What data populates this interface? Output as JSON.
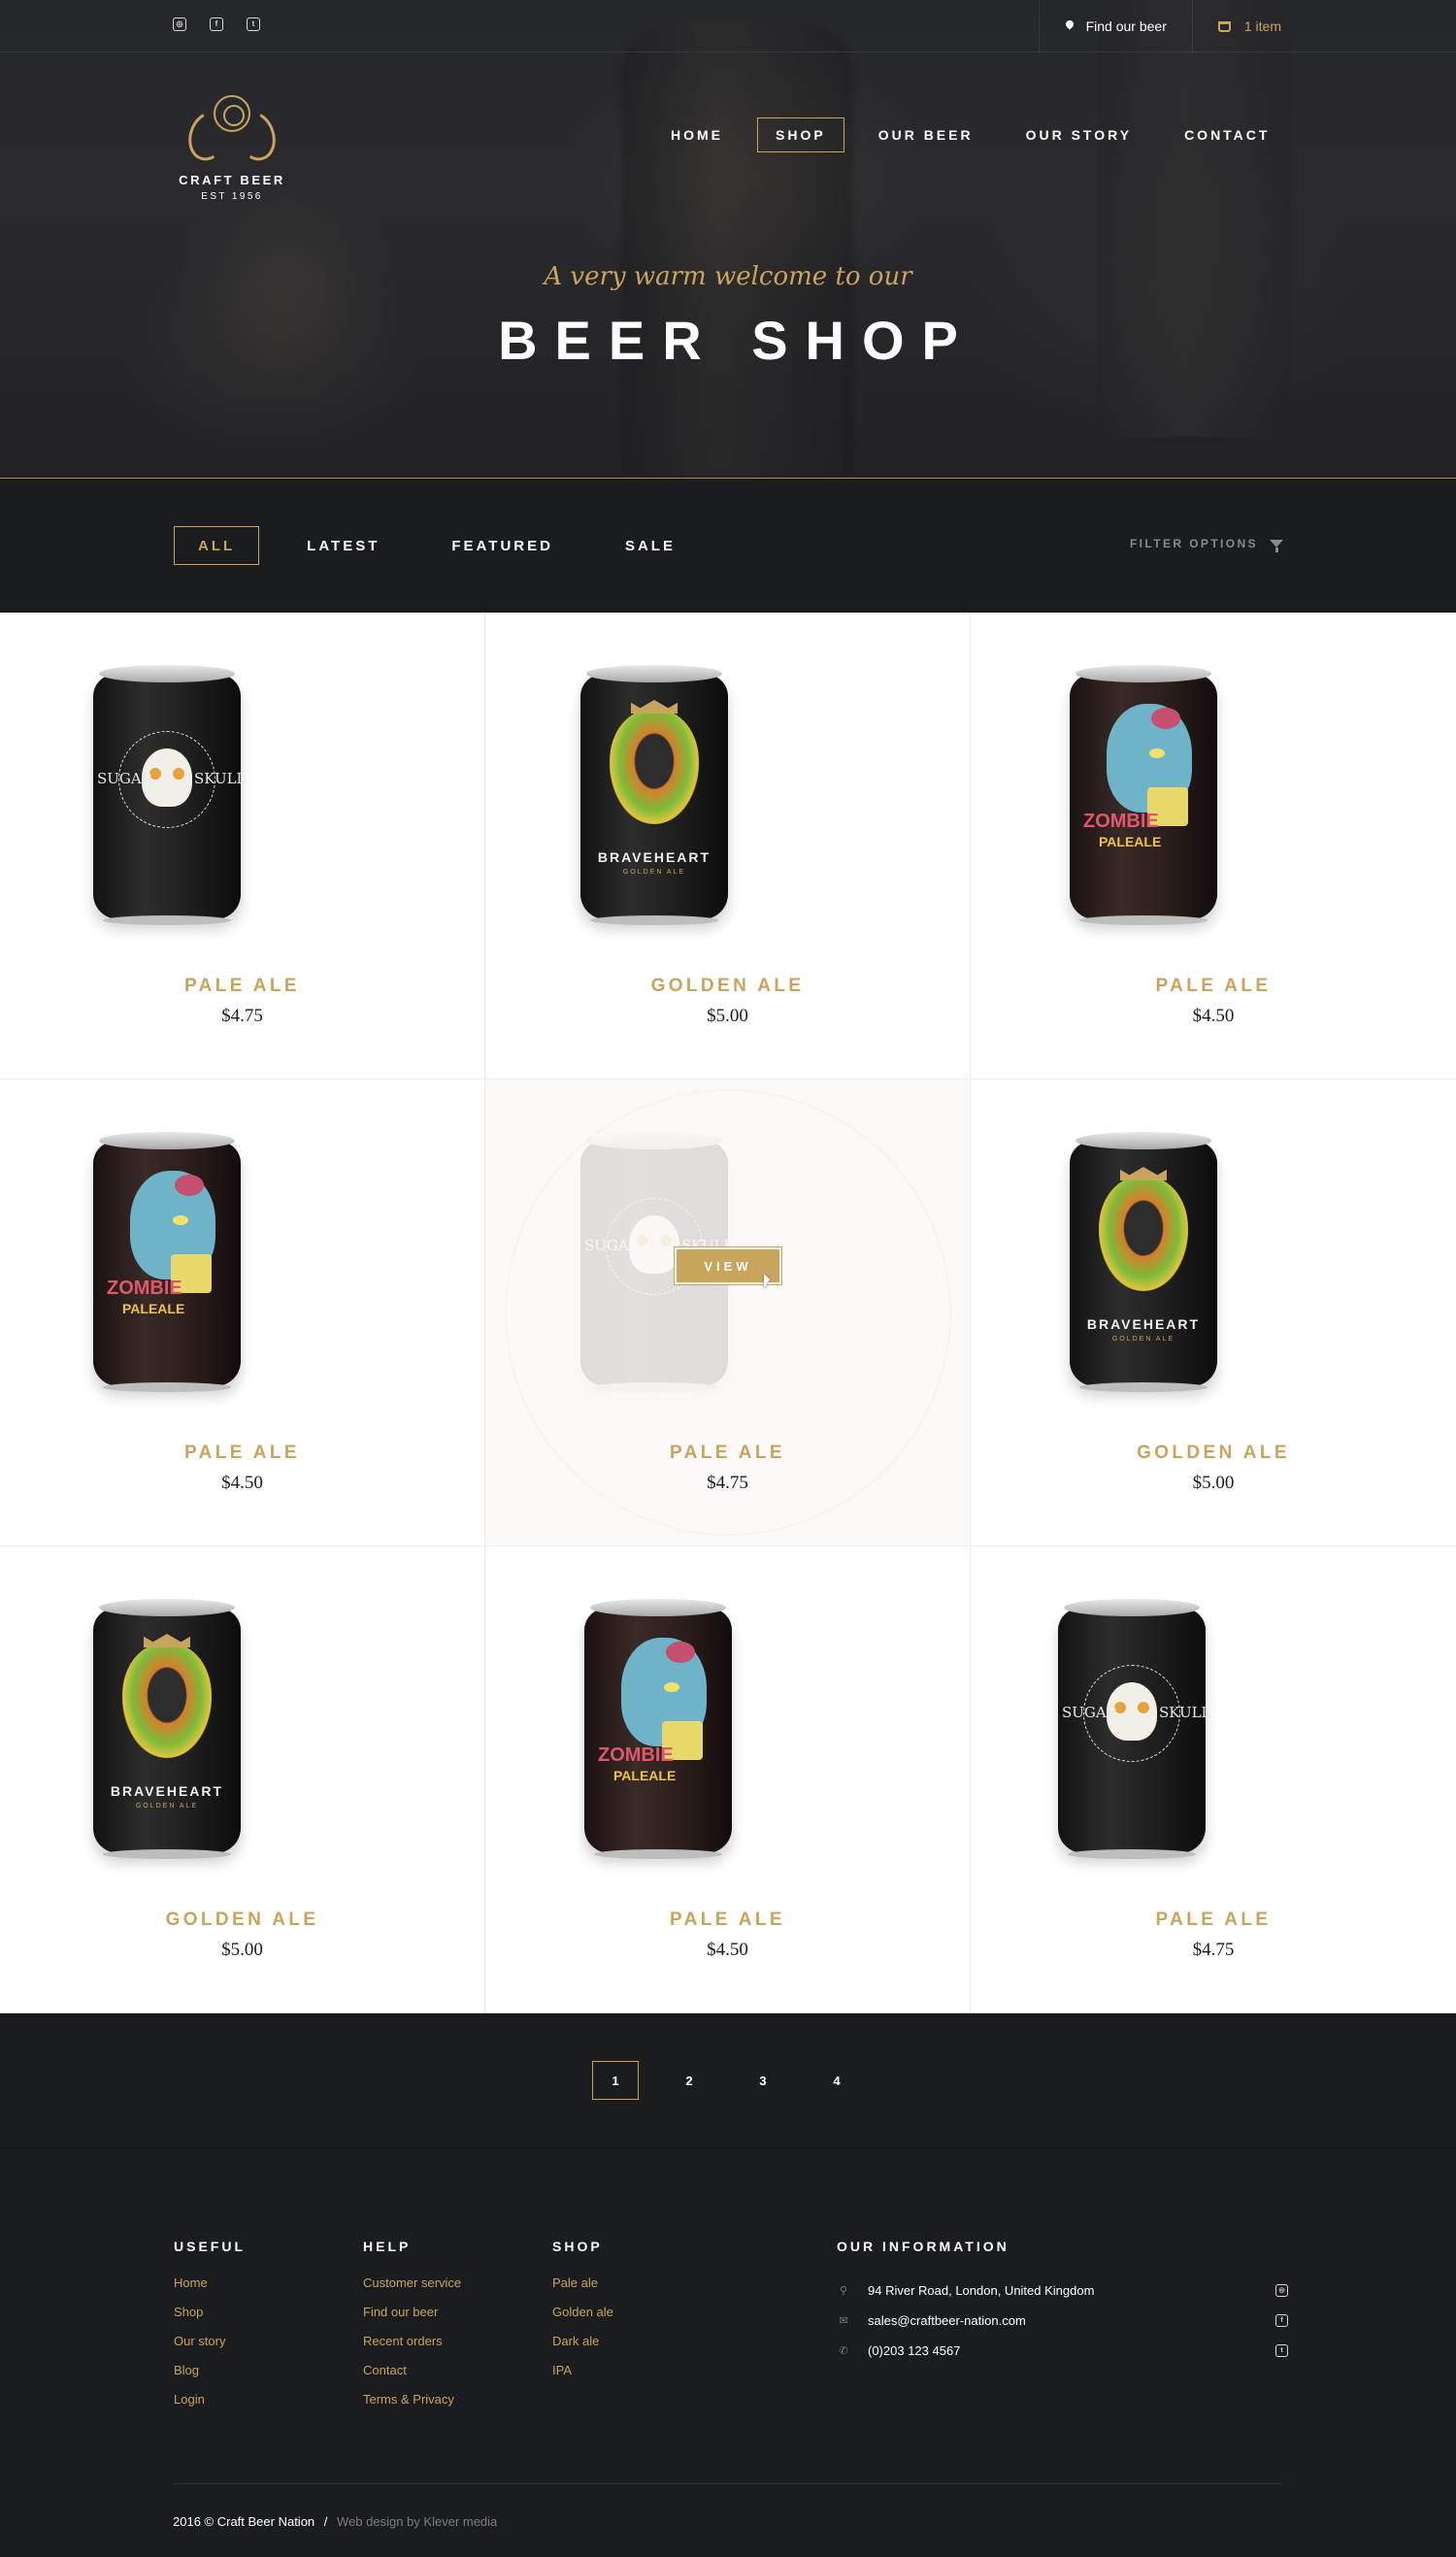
{
  "header": {
    "socials": [
      "instagram-icon",
      "facebook-icon",
      "twitter-icon"
    ],
    "find_beer": "Find our beer",
    "cart": "1 item"
  },
  "logo": {
    "name": "CRAFT BEER",
    "est": "EST 1956"
  },
  "nav": [
    "HOME",
    "SHOP",
    "OUR BEER",
    "OUR STORY",
    "CONTACT"
  ],
  "nav_active": "SHOP",
  "hero": {
    "welcome": "A very warm welcome to our",
    "title": "BEER SHOP"
  },
  "filters": {
    "tabs": [
      "ALL",
      "LATEST",
      "FEATURED",
      "SALE"
    ],
    "active": "ALL",
    "options_label": "FILTER OPTIONS"
  },
  "products": [
    {
      "name": "PALE ALE",
      "price": "$4.75",
      "can": "sugar-skull"
    },
    {
      "name": "GOLDEN ALE",
      "price": "$5.00",
      "can": "braveheart"
    },
    {
      "name": "PALE ALE",
      "price": "$4.50",
      "can": "zombie"
    },
    {
      "name": "PALE ALE",
      "price": "$4.50",
      "can": "zombie"
    },
    {
      "name": "PALE ALE",
      "price": "$4.75",
      "can": "sugar-skull",
      "hovered": true,
      "hover_label": "VIEW"
    },
    {
      "name": "GOLDEN ALE",
      "price": "$5.00",
      "can": "braveheart"
    },
    {
      "name": "GOLDEN ALE",
      "price": "$5.00",
      "can": "braveheart"
    },
    {
      "name": "PALE ALE",
      "price": "$4.50",
      "can": "zombie"
    },
    {
      "name": "PALE ALE",
      "price": "$4.75",
      "can": "sugar-skull"
    }
  ],
  "can_text": {
    "skull_left": "SUGAR",
    "skull_right": "SKULL",
    "lion_main": "BRAVEHEART",
    "lion_sub": "GOLDEN ALE",
    "zombie_main": "ZOMBIE",
    "zombie_sub": "PALEALE"
  },
  "pagination": {
    "pages": [
      "1",
      "2",
      "3",
      "4"
    ],
    "active": "1"
  },
  "footer": {
    "useful": {
      "title": "USEFUL",
      "links": [
        "Home",
        "Shop",
        "Our story",
        "Blog",
        "Login"
      ]
    },
    "help": {
      "title": "HELP",
      "links": [
        "Customer service",
        "Find our beer",
        "Recent orders",
        "Contact",
        "Terms & Privacy"
      ]
    },
    "shop": {
      "title": "SHOP",
      "links": [
        "Pale ale",
        "Golden ale",
        "Dark ale",
        "IPA"
      ]
    },
    "info": {
      "title": "OUR INFORMATION",
      "address": "94 River Road, London, United Kingdom",
      "email": "sales@craftbeer-nation.com",
      "phone": "(0)203 123 4567"
    },
    "copyright": "2016 © Craft Beer Nation",
    "separator": "/",
    "credit": "Web design by Klever media"
  },
  "colors": {
    "accent": "#c9a45c",
    "dark": "#1b1c1f"
  }
}
